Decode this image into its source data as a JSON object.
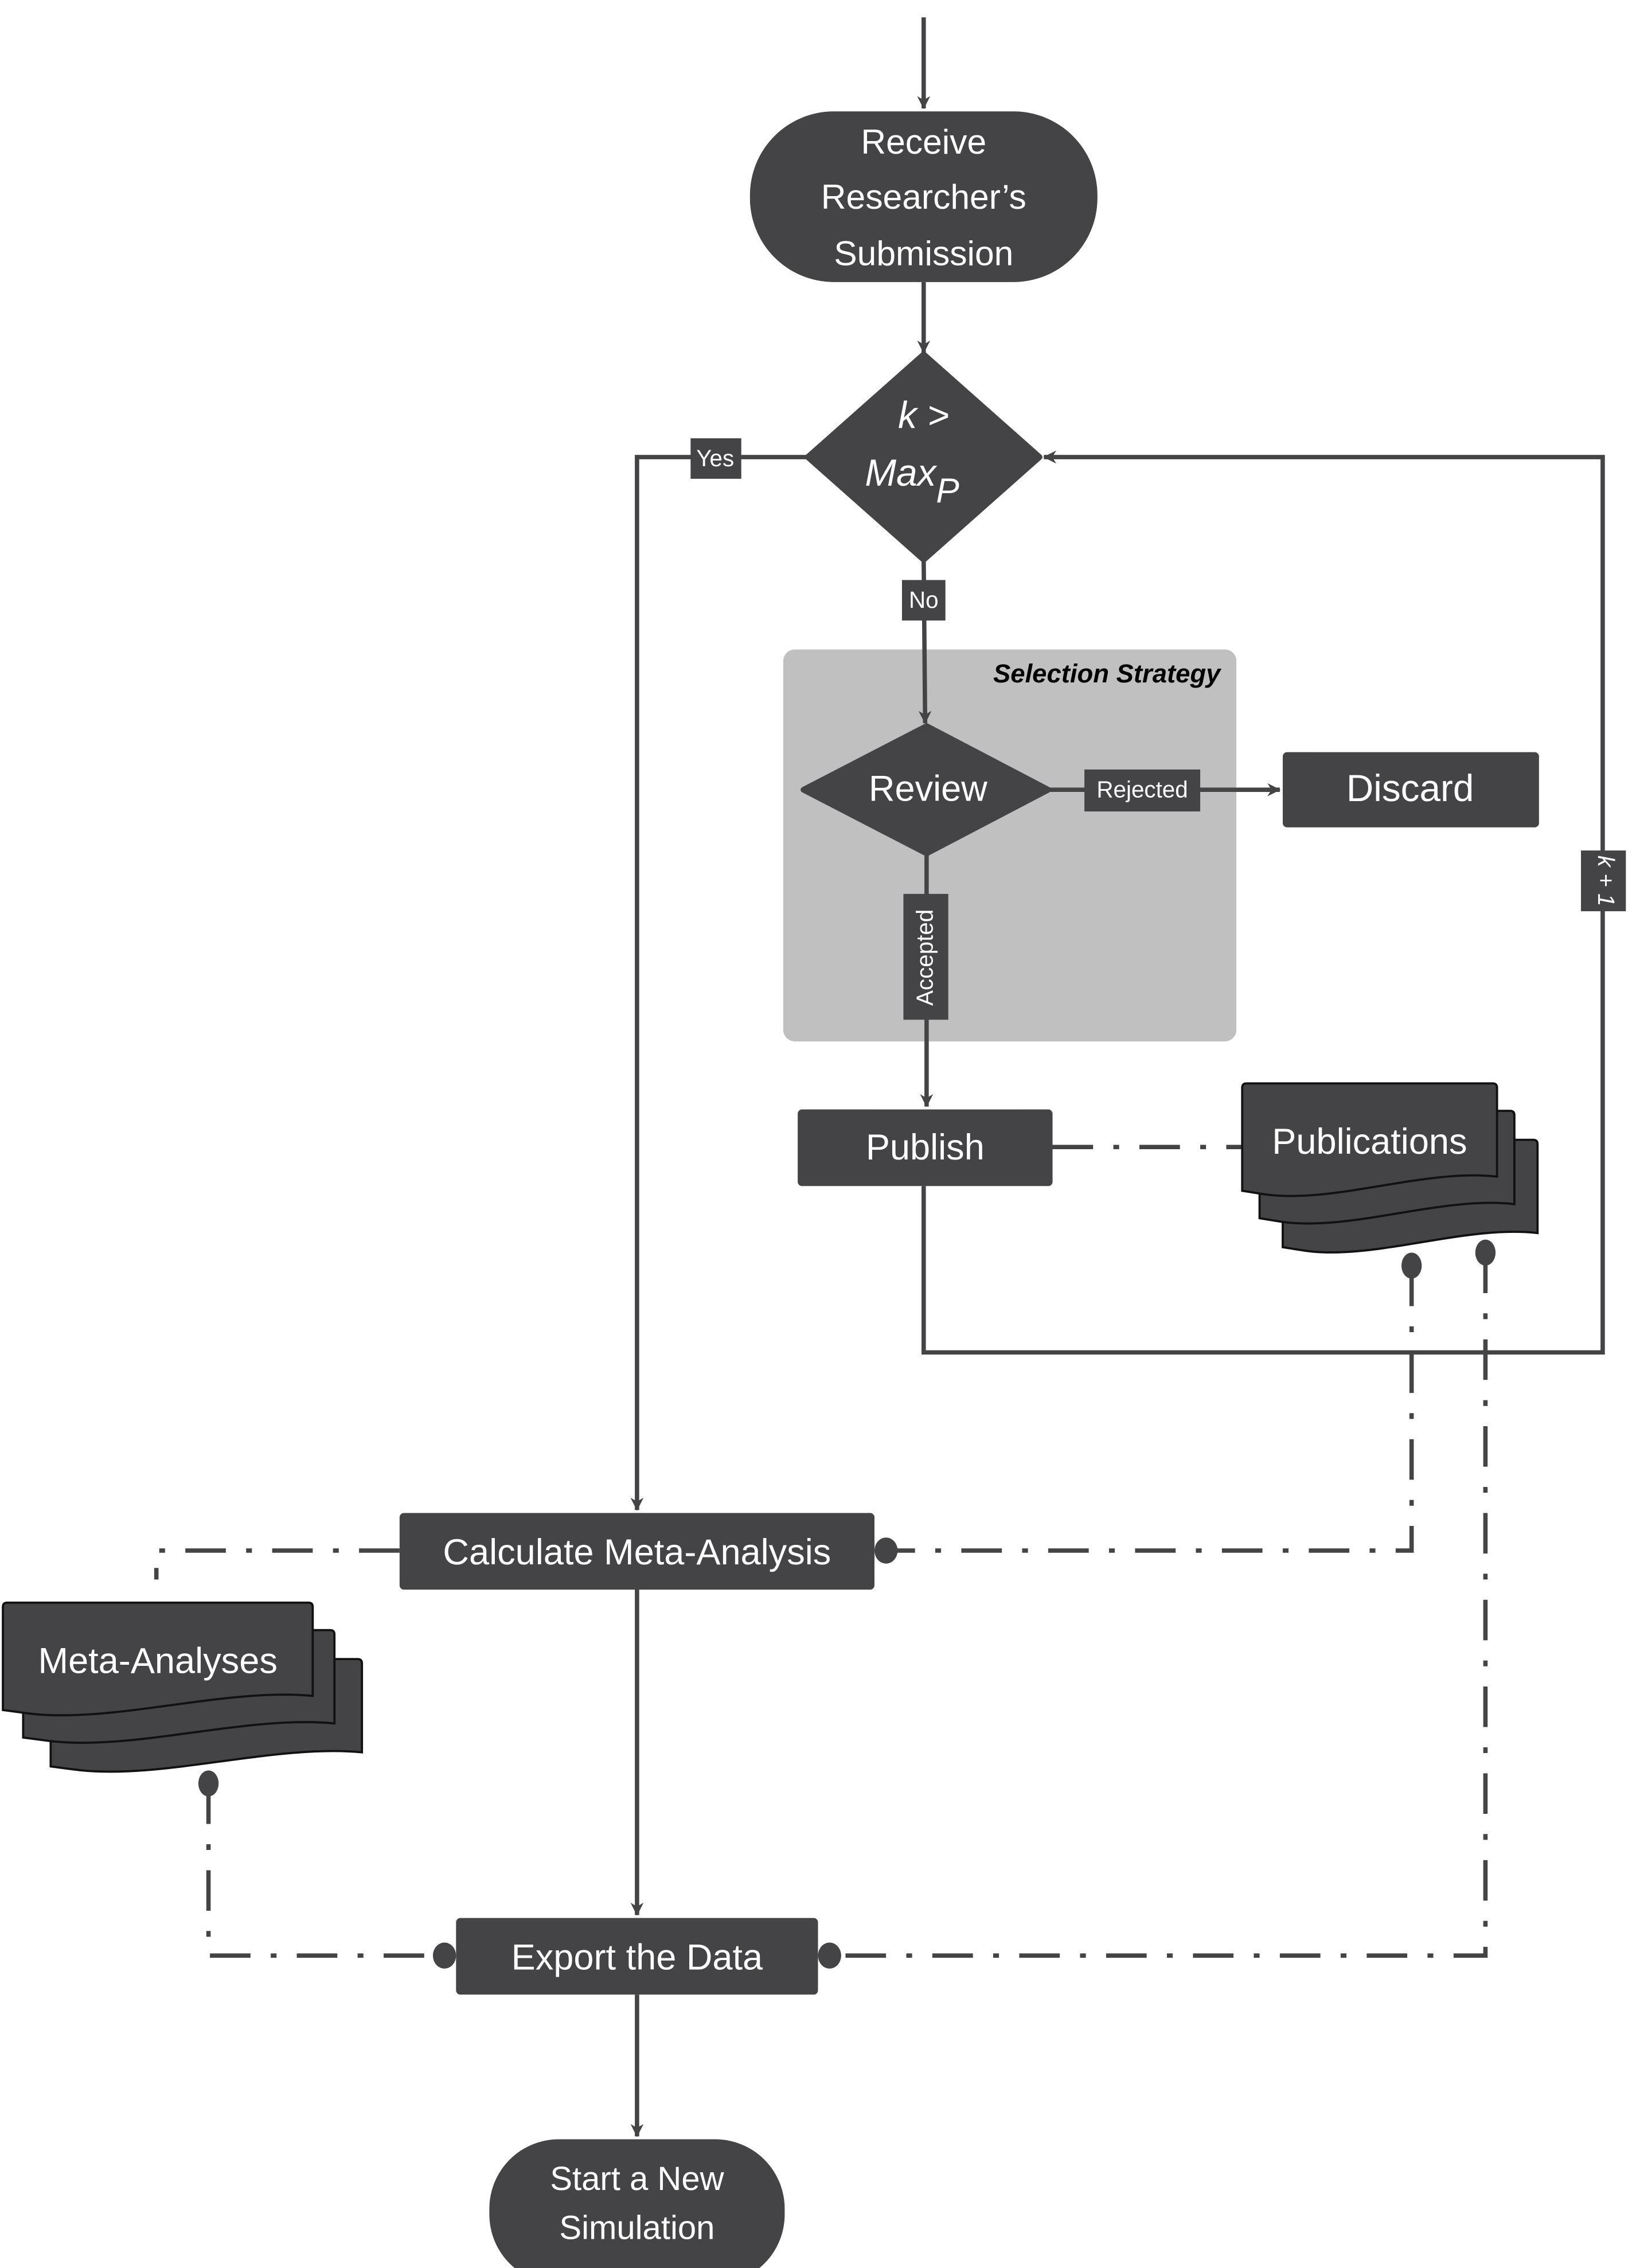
{
  "colors": {
    "node": "#444446",
    "group": "#c0c0c0",
    "background": "#ffffff",
    "text": "#ffffff"
  },
  "nodes": {
    "receive": [
      "Receive",
      "Researcher’s",
      "Submission"
    ],
    "decision": {
      "line1": "k >",
      "line2": "Max",
      "sub": "P"
    },
    "review": "Review",
    "discard": "Discard",
    "publish": "Publish",
    "publications": "Publications",
    "calculate": "Calculate Meta-Analysis",
    "meta_analyses": "Meta-Analyses",
    "export": "Export the Data",
    "start_new": [
      "Start a New",
      "Simulation"
    ]
  },
  "group": {
    "title": "Selection Strategy"
  },
  "edge_labels": {
    "yes": "Yes",
    "no": "No",
    "rejected": "Rejected",
    "accepted": "Accepted",
    "k_plus_1": "k + 1"
  }
}
